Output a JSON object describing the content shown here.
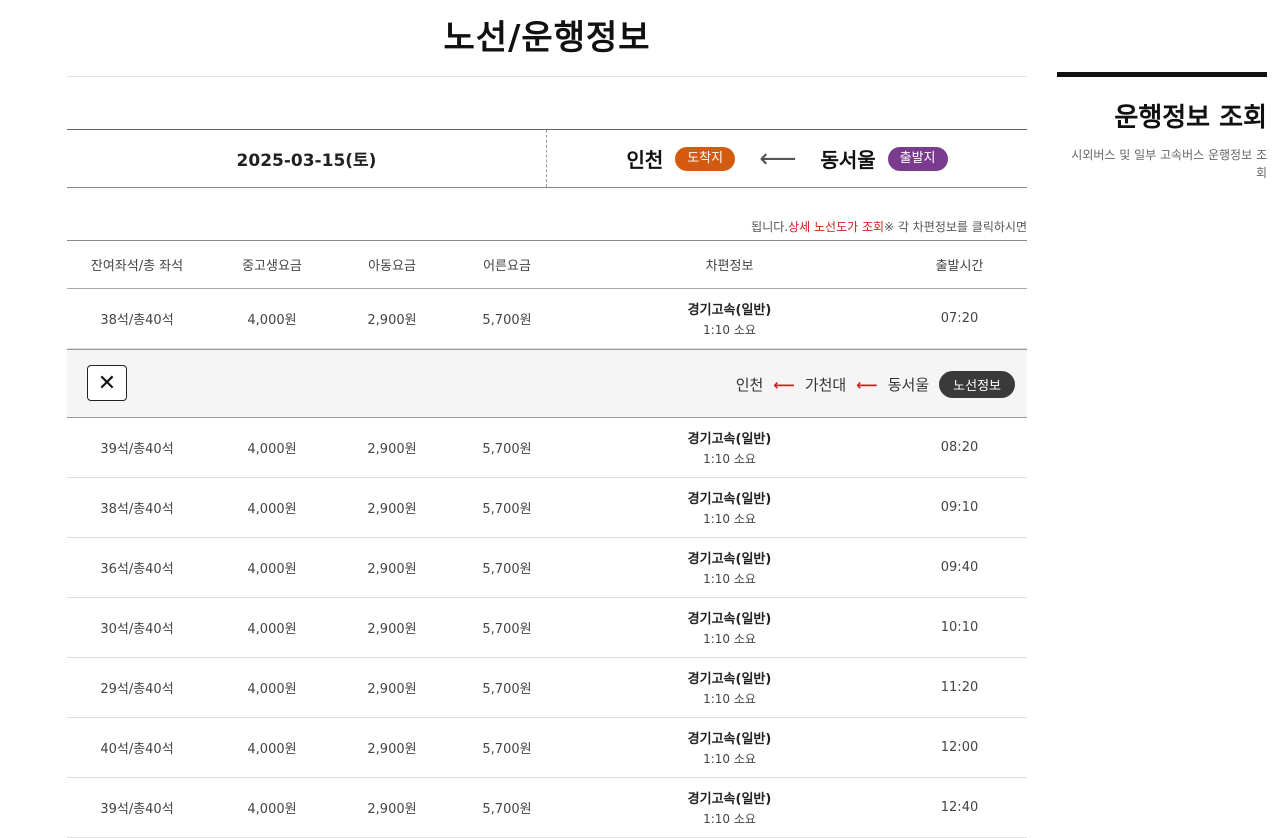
{
  "page_title": "노선/운행정보",
  "sidebar": {
    "title": "운행정보 조회",
    "description": "시외버스 및 일부 고속버스 운행정보 조회"
  },
  "route": {
    "date": "2025-03-15(토)",
    "departure_label": "출발지",
    "departure_city": "동서울",
    "arrival_label": "도착지",
    "arrival_city": "인천"
  },
  "notice": {
    "prefix": "※ 각 차편정보를 클릭하시면 ",
    "highlight": "상세 노선도가 조회",
    "suffix": "됩니다."
  },
  "table": {
    "headers": [
      "출발시간",
      "차편정보",
      "어른요금",
      "아동요금",
      "중고생요금",
      "잔여좌석/총 좌석"
    ],
    "rows": [
      {
        "time": "07:20",
        "bus": "경기고속(일반)",
        "duration": "1:10 소요",
        "adult": "5,700원",
        "child": "2,900원",
        "student": "4,000원",
        "seats": "38석/총40석"
      },
      {
        "time": "08:20",
        "bus": "경기고속(일반)",
        "duration": "1:10 소요",
        "adult": "5,700원",
        "child": "2,900원",
        "student": "4,000원",
        "seats": "39석/총40석"
      },
      {
        "time": "09:10",
        "bus": "경기고속(일반)",
        "duration": "1:10 소요",
        "adult": "5,700원",
        "child": "2,900원",
        "student": "4,000원",
        "seats": "38석/총40석"
      },
      {
        "time": "09:40",
        "bus": "경기고속(일반)",
        "duration": "1:10 소요",
        "adult": "5,700원",
        "child": "2,900원",
        "student": "4,000원",
        "seats": "36석/총40석"
      },
      {
        "time": "10:10",
        "bus": "경기고속(일반)",
        "duration": "1:10 소요",
        "adult": "5,700원",
        "child": "2,900원",
        "student": "4,000원",
        "seats": "30석/총40석"
      },
      {
        "time": "11:20",
        "bus": "경기고속(일반)",
        "duration": "1:10 소요",
        "adult": "5,700원",
        "child": "2,900원",
        "student": "4,000원",
        "seats": "29석/총40석"
      },
      {
        "time": "12:00",
        "bus": "경기고속(일반)",
        "duration": "1:10 소요",
        "adult": "5,700원",
        "child": "2,900원",
        "student": "4,000원",
        "seats": "40석/총40석"
      },
      {
        "time": "12:40",
        "bus": "경기고속(일반)",
        "duration": "1:10 소요",
        "adult": "5,700원",
        "child": "2,900원",
        "student": "4,000원",
        "seats": "39석/총40석"
      }
    ]
  },
  "route_detail": {
    "label": "노선정보",
    "stops": [
      "동서울",
      "가천대",
      "인천"
    ],
    "arrow": "⟵",
    "close": "✕"
  },
  "colors": {
    "departure_pill": "#7a3b8e",
    "arrival_pill": "#d45a0f",
    "highlight_red": "#d42020"
  }
}
